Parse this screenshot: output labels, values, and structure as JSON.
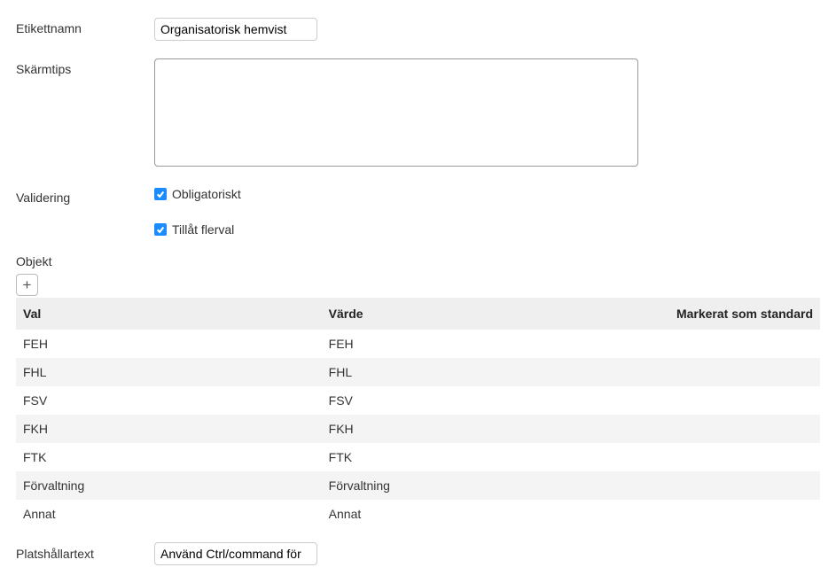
{
  "fields": {
    "labelName": {
      "label": "Etikettnamn",
      "value": "Organisatorisk hemvist"
    },
    "tooltip": {
      "label": "Skärmtips",
      "value": ""
    },
    "validation": {
      "label": "Validering",
      "mandatory": {
        "label": "Obligatoriskt",
        "checked": true
      },
      "allowMultiple": {
        "label": "Tillåt flerval",
        "checked": true
      }
    },
    "object": {
      "label": "Objekt"
    },
    "placeholder": {
      "label": "Platshållartext",
      "value": "Använd Ctrl/command för"
    }
  },
  "table": {
    "headers": {
      "choice": "Val",
      "value": "Värde",
      "default": "Markerat som standard"
    },
    "rows": [
      {
        "choice": "FEH",
        "value": "FEH"
      },
      {
        "choice": "FHL",
        "value": "FHL"
      },
      {
        "choice": "FSV",
        "value": "FSV"
      },
      {
        "choice": "FKH",
        "value": "FKH"
      },
      {
        "choice": "FTK",
        "value": "FTK"
      },
      {
        "choice": "Förvaltning",
        "value": "Förvaltning"
      },
      {
        "choice": "Annat",
        "value": "Annat"
      }
    ]
  }
}
